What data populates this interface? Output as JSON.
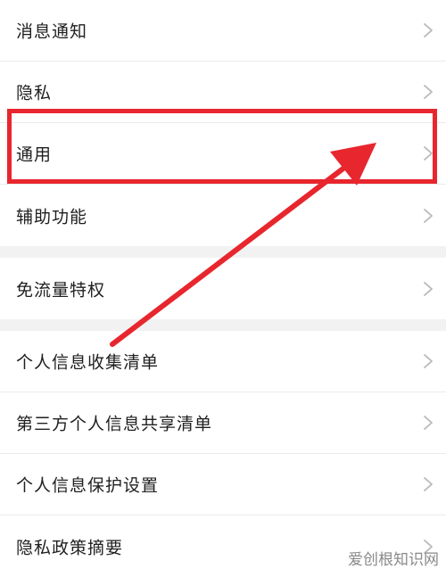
{
  "settings": {
    "group1": [
      {
        "label": "消息通知"
      },
      {
        "label": "隐私"
      },
      {
        "label": "通用"
      },
      {
        "label": "辅助功能"
      }
    ],
    "group2": [
      {
        "label": "免流量特权"
      }
    ],
    "group3": [
      {
        "label": "个人信息收集清单"
      },
      {
        "label": "第三方个人信息共享清单"
      },
      {
        "label": "个人信息保护设置"
      },
      {
        "label": "隐私政策摘要"
      }
    ]
  },
  "watermark": {
    "text": "爱创根知识网"
  },
  "colors": {
    "annotation": "#e8262e",
    "separator": "#f2f2f2",
    "chevron": "#b8b8b8"
  }
}
